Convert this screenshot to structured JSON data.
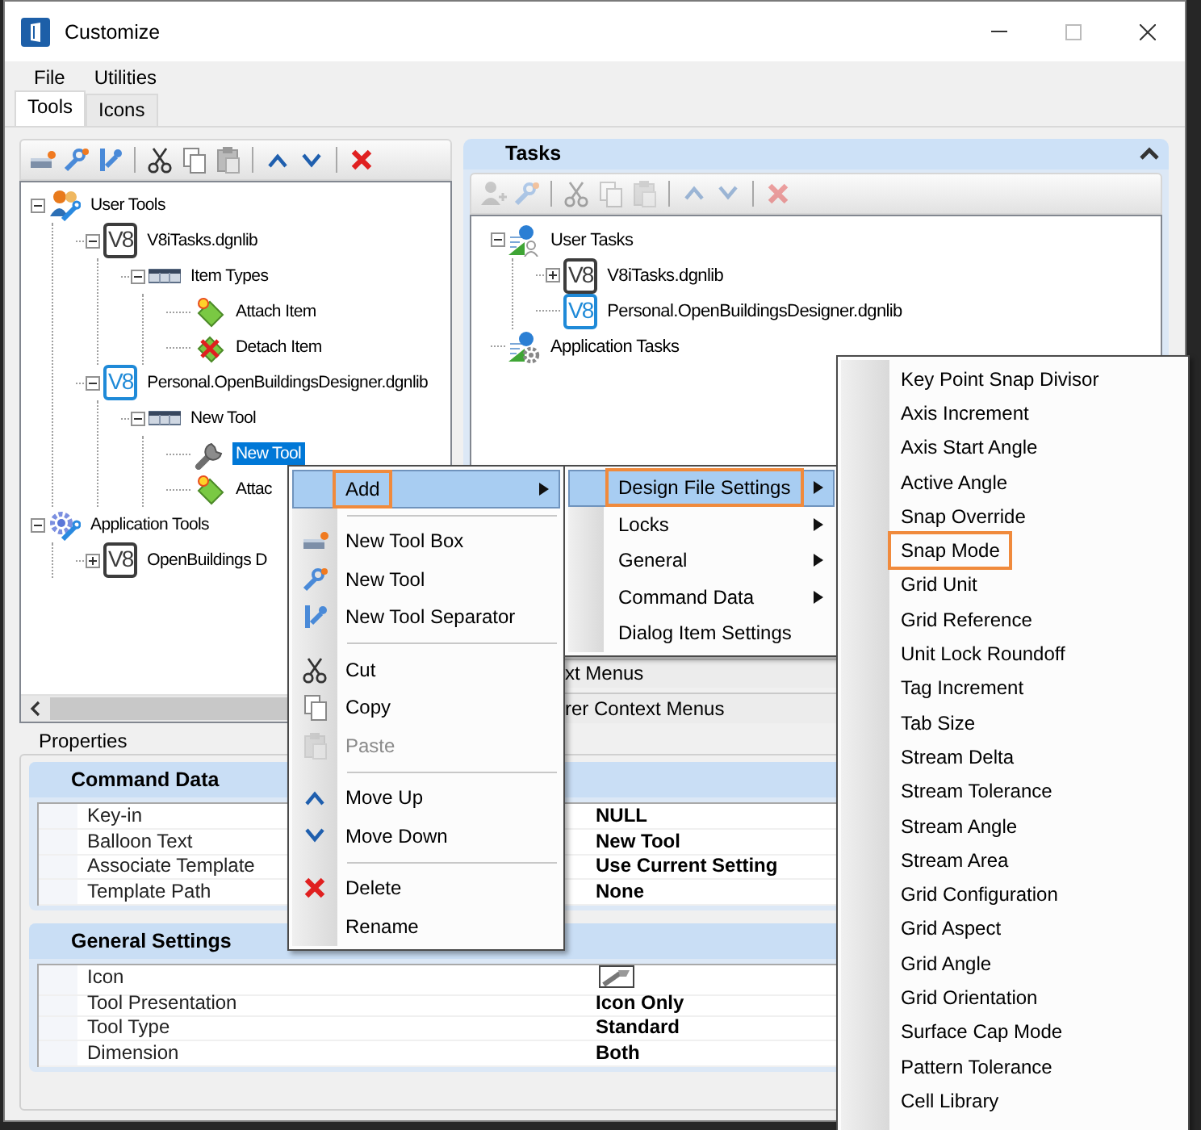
{
  "window": {
    "title": "Customize"
  },
  "menu_bar": [
    "File",
    "Utilities"
  ],
  "tabs": [
    {
      "label": "Tools",
      "selected": true
    },
    {
      "label": "Icons",
      "selected": false
    }
  ],
  "tools_toolbar": [
    {
      "kind": "toolbox-add",
      "disabled": false
    },
    {
      "kind": "tool-add",
      "disabled": false
    },
    {
      "kind": "separator-add",
      "disabled": false
    },
    {
      "kind": "divider"
    },
    {
      "kind": "cut",
      "disabled": false
    },
    {
      "kind": "copy",
      "disabled": false
    },
    {
      "kind": "paste",
      "disabled": false
    },
    {
      "kind": "divider"
    },
    {
      "kind": "up",
      "disabled": false
    },
    {
      "kind": "down",
      "disabled": false
    },
    {
      "kind": "divider"
    },
    {
      "kind": "delete",
      "disabled": false
    }
  ],
  "tools_tree": [
    {
      "label": "User Tools",
      "kind": "users",
      "expanded": true,
      "selected": false,
      "children": [
        {
          "label": "V8iTasks.dgnlib",
          "kind": "library",
          "badge": "V8",
          "color": "#3c3c3c",
          "expanded": true,
          "selected": false,
          "children": [
            {
              "label": "Item Types",
              "kind": "toolbox",
              "expanded": true,
              "selected": false,
              "children": [
                {
                  "label": "Attach Item",
                  "kind": "attach",
                  "selected": false
                },
                {
                  "label": "Detach Item",
                  "kind": "detach",
                  "selected": false
                }
              ]
            }
          ]
        },
        {
          "label": "Personal.OpenBuildingsDesigner.dgnlib",
          "kind": "library",
          "badge": "V8",
          "color": "#1f8ad8",
          "expanded": true,
          "selected": false,
          "children": [
            {
              "label": "New Tool",
              "kind": "toolbox",
              "expanded": true,
              "selected": false,
              "children": [
                {
                  "label": "New Tool",
                  "kind": "wrench",
                  "selected": true
                },
                {
                  "label": "Attac",
                  "kind": "attach",
                  "selected": false
                }
              ]
            }
          ]
        }
      ]
    },
    {
      "label": "Application Tools",
      "kind": "app-tools",
      "expanded": true,
      "selected": false,
      "children": [
        {
          "label": "OpenBuildings D",
          "kind": "library",
          "badge": "V8",
          "color": "#3c3c3c",
          "expanded": false,
          "selected": false
        }
      ]
    }
  ],
  "tasks": {
    "title": "Tasks",
    "toolbar": [
      {
        "kind": "task-add",
        "disabled": true
      },
      {
        "kind": "tool-add",
        "disabled": true
      },
      {
        "kind": "divider"
      },
      {
        "kind": "cut",
        "disabled": true
      },
      {
        "kind": "copy",
        "disabled": true
      },
      {
        "kind": "paste",
        "disabled": true
      },
      {
        "kind": "divider"
      },
      {
        "kind": "up",
        "disabled": true
      },
      {
        "kind": "down",
        "disabled": true
      },
      {
        "kind": "divider"
      },
      {
        "kind": "delete",
        "disabled": true
      }
    ],
    "tree": [
      {
        "label": "User Tasks",
        "kind": "user-tasks",
        "expanded": true,
        "selected": false,
        "children": [
          {
            "label": "V8iTasks.dgnlib",
            "kind": "library",
            "badge": "V8",
            "color": "#3c3c3c",
            "expanded": false,
            "selected": false
          },
          {
            "label": "Personal.OpenBuildingsDesigner.dgnlib",
            "kind": "library",
            "badge": "V8",
            "color": "#1f8ad8",
            "selected": false
          }
        ]
      },
      {
        "label": "Application Tasks",
        "kind": "app-tasks",
        "selected": false
      }
    ],
    "sections": [
      "xt Menus",
      "rer Context Menus"
    ]
  },
  "properties": {
    "label": "Properties",
    "groups": [
      {
        "title": "Command Data",
        "rows": [
          {
            "kind": "text",
            "label": "Key-in",
            "value": "NULL"
          },
          {
            "kind": "text",
            "label": "Balloon Text",
            "value": "New Tool"
          },
          {
            "kind": "text",
            "label": "Associate Template",
            "value": "Use Current Setting"
          },
          {
            "kind": "text",
            "label": "Template Path",
            "value": "None"
          }
        ]
      },
      {
        "title": "General Settings",
        "rows": [
          {
            "kind": "icon",
            "label": "Icon"
          },
          {
            "kind": "text",
            "label": "Tool Presentation",
            "value": "Icon Only"
          },
          {
            "kind": "text",
            "label": "Tool Type",
            "value": "Standard"
          },
          {
            "kind": "text",
            "label": "Dimension",
            "value": "Both"
          }
        ]
      }
    ]
  },
  "context_menu": [
    {
      "kind": "plain",
      "label": "Add",
      "submenu": true,
      "selected": true,
      "outlined": true,
      "disabled": false
    },
    {
      "kind": "separator"
    },
    {
      "kind": "toolbox-add",
      "label": "New Tool Box",
      "selected": false,
      "disabled": false
    },
    {
      "kind": "tool-add",
      "label": "New Tool",
      "selected": false,
      "disabled": false
    },
    {
      "kind": "separator-add",
      "label": "New Tool Separator",
      "selected": false,
      "disabled": false
    },
    {
      "kind": "separator"
    },
    {
      "kind": "cut",
      "label": "Cut",
      "selected": false,
      "disabled": false
    },
    {
      "kind": "copy",
      "label": "Copy",
      "selected": false,
      "disabled": false
    },
    {
      "kind": "paste",
      "label": "Paste",
      "selected": false,
      "disabled": true
    },
    {
      "kind": "separator"
    },
    {
      "kind": "up",
      "label": "Move Up",
      "selected": false,
      "disabled": false
    },
    {
      "kind": "down",
      "label": "Move Down",
      "selected": false,
      "disabled": false
    },
    {
      "kind": "separator"
    },
    {
      "kind": "delete",
      "label": "Delete",
      "selected": false,
      "disabled": false
    },
    {
      "kind": "plain",
      "label": "Rename",
      "selected": false,
      "disabled": false
    }
  ],
  "add_submenu": [
    {
      "label": "Design File Settings",
      "submenu": true,
      "selected": true,
      "outlined": true
    },
    {
      "label": "Locks",
      "submenu": true,
      "selected": false
    },
    {
      "label": "General",
      "submenu": true,
      "selected": false
    },
    {
      "label": "Command Data",
      "submenu": true,
      "selected": false
    },
    {
      "label": "Dialog Item Settings",
      "submenu": false,
      "selected": false
    }
  ],
  "design_file_settings_menu": [
    {
      "label": "Key Point Snap Divisor",
      "selected": false
    },
    {
      "label": "Axis Increment",
      "selected": false
    },
    {
      "label": "Axis Start Angle",
      "selected": false
    },
    {
      "label": "Active Angle",
      "selected": false
    },
    {
      "label": "Snap Override",
      "selected": false
    },
    {
      "label": "Snap Mode",
      "selected": false,
      "outlined": true
    },
    {
      "label": "Grid Unit",
      "selected": false
    },
    {
      "label": "Grid Reference",
      "selected": false
    },
    {
      "label": "Unit Lock Roundoff",
      "selected": false
    },
    {
      "label": "Tag Increment",
      "selected": false
    },
    {
      "label": "Tab Size",
      "selected": false
    },
    {
      "label": "Stream Delta",
      "selected": false
    },
    {
      "label": "Stream Tolerance",
      "selected": false
    },
    {
      "label": "Stream Angle",
      "selected": false
    },
    {
      "label": "Stream Area",
      "selected": false
    },
    {
      "label": "Grid Configuration",
      "selected": false
    },
    {
      "label": "Grid Aspect",
      "selected": false
    },
    {
      "label": "Grid Angle",
      "selected": false
    },
    {
      "label": "Grid Orientation",
      "selected": false
    },
    {
      "label": "Surface Cap Mode",
      "selected": false
    },
    {
      "label": "Pattern Tolerance",
      "selected": false
    },
    {
      "label": "Cell Library",
      "selected": false
    }
  ]
}
